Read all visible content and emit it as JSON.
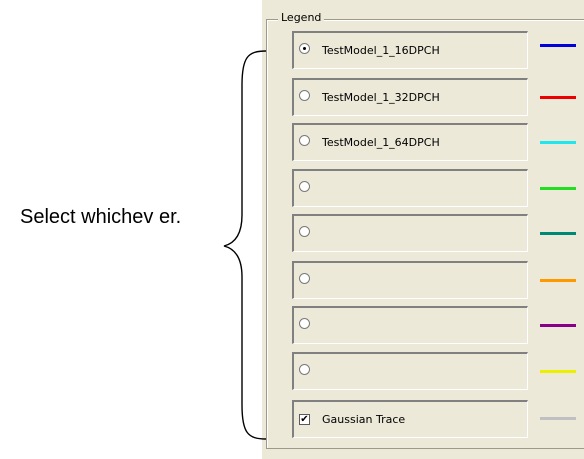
{
  "legend": {
    "title": "Legend",
    "rows": [
      {
        "label": "TestModel_1_16DPCH",
        "control": "radio",
        "checked": true,
        "color": "#0000dd"
      },
      {
        "label": "TestModel_1_32DPCH",
        "control": "radio",
        "checked": false,
        "color": "#ee0000"
      },
      {
        "label": "TestModel_1_64DPCH",
        "control": "radio",
        "checked": false,
        "color": "#22e6ee"
      },
      {
        "label": "",
        "control": "radio",
        "checked": false,
        "color": "#22dd22"
      },
      {
        "label": "",
        "control": "radio",
        "checked": false,
        "color": "#008877"
      },
      {
        "label": "",
        "control": "radio",
        "checked": false,
        "color": "#ff9900"
      },
      {
        "label": "",
        "control": "radio",
        "checked": false,
        "color": "#880088"
      },
      {
        "label": "",
        "control": "radio",
        "checked": false,
        "color": "#eeee00"
      },
      {
        "label": "Gaussian Trace",
        "control": "checkbox",
        "checked": true,
        "color": "#c0c0c0"
      }
    ]
  },
  "annotation": {
    "text": "Select whichev er."
  }
}
